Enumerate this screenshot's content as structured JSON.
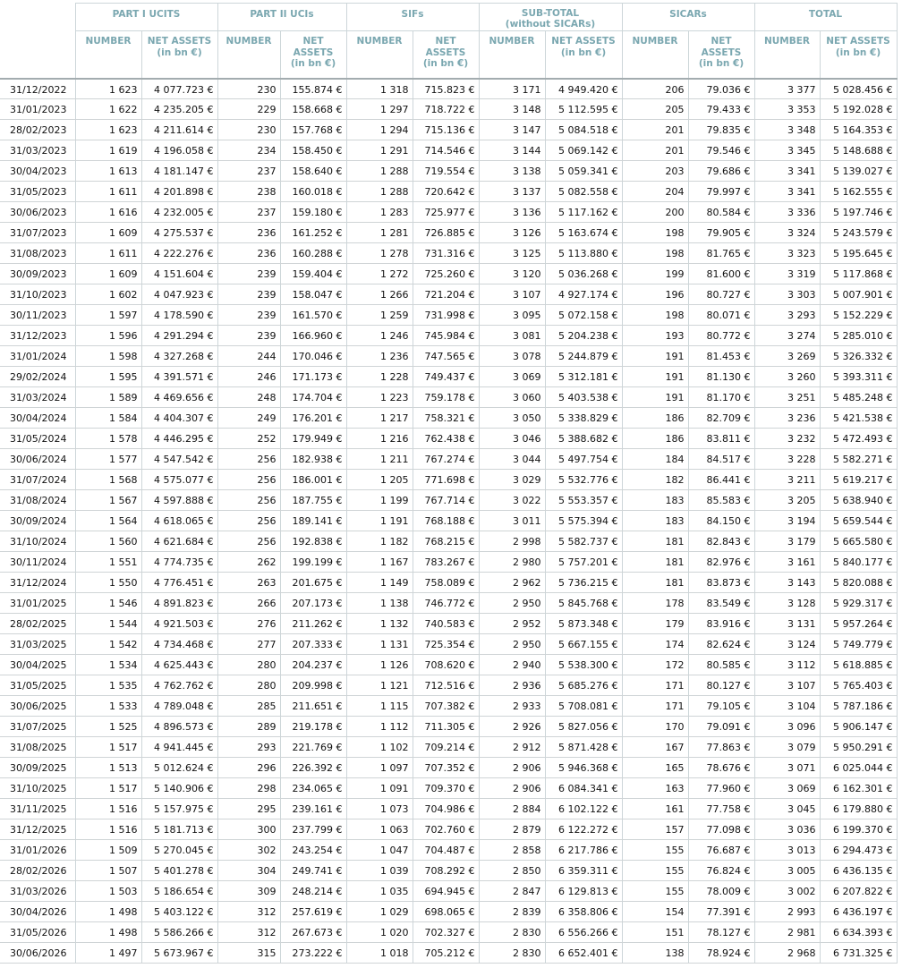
{
  "header": {
    "groups": [
      "PART I UCITS",
      "PART II UCIs",
      "SIFs",
      "SUB-TOTAL\n(without SICARs)",
      "SICARs",
      "TOTAL"
    ],
    "sub": {
      "number": "NUMBER",
      "assets_a": "NET ASSETS\n(in bn €)",
      "assets_b": "NET\nASSETS\n(in bn €)"
    }
  },
  "rows": [
    [
      "31/12/2022",
      "1 623",
      "4 077.723 €",
      "230",
      "155.874 €",
      "1 318",
      "715.823 €",
      "3 171",
      "4 949.420 €",
      "206",
      "79.036 €",
      "3 377",
      "5 028.456 €"
    ],
    [
      "31/01/2023",
      "1 622",
      "4 235.205 €",
      "229",
      "158.668 €",
      "1 297",
      "718.722 €",
      "3 148",
      "5 112.595 €",
      "205",
      "79.433 €",
      "3 353",
      "5 192.028 €"
    ],
    [
      "28/02/2023",
      "1 623",
      "4 211.614 €",
      "230",
      "157.768 €",
      "1 294",
      "715.136 €",
      "3 147",
      "5 084.518 €",
      "201",
      "79.835 €",
      "3 348",
      "5 164.353 €"
    ],
    [
      "31/03/2023",
      "1 619",
      "4 196.058 €",
      "234",
      "158.450 €",
      "1 291",
      "714.546 €",
      "3 144",
      "5 069.142 €",
      "201",
      "79.546 €",
      "3 345",
      "5 148.688 €"
    ],
    [
      "30/04/2023",
      "1 613",
      "4 181.147 €",
      "237",
      "158.640 €",
      "1 288",
      "719.554 €",
      "3 138",
      "5 059.341 €",
      "203",
      "79.686 €",
      "3 341",
      "5 139.027 €"
    ],
    [
      "31/05/2023",
      "1 611",
      "4 201.898 €",
      "238",
      "160.018 €",
      "1 288",
      "720.642 €",
      "3 137",
      "5 082.558 €",
      "204",
      "79.997 €",
      "3 341",
      "5 162.555 €"
    ],
    [
      "30/06/2023",
      "1 616",
      "4 232.005 €",
      "237",
      "159.180 €",
      "1 283",
      "725.977 €",
      "3 136",
      "5 117.162 €",
      "200",
      "80.584 €",
      "3 336",
      "5 197.746 €"
    ],
    [
      "31/07/2023",
      "1 609",
      "4 275.537 €",
      "236",
      "161.252 €",
      "1 281",
      "726.885 €",
      "3 126",
      "5 163.674 €",
      "198",
      "79.905 €",
      "3 324",
      "5 243.579 €"
    ],
    [
      "31/08/2023",
      "1 611",
      "4 222.276 €",
      "236",
      "160.288 €",
      "1 278",
      "731.316 €",
      "3 125",
      "5 113.880 €",
      "198",
      "81.765 €",
      "3 323",
      "5 195.645 €"
    ],
    [
      "30/09/2023",
      "1 609",
      "4 151.604 €",
      "239",
      "159.404 €",
      "1 272",
      "725.260 €",
      "3 120",
      "5 036.268 €",
      "199",
      "81.600 €",
      "3 319",
      "5 117.868 €"
    ],
    [
      "31/10/2023",
      "1 602",
      "4 047.923 €",
      "239",
      "158.047 €",
      "1 266",
      "721.204 €",
      "3 107",
      "4 927.174 €",
      "196",
      "80.727 €",
      "3 303",
      "5 007.901 €"
    ],
    [
      "30/11/2023",
      "1 597",
      "4 178.590 €",
      "239",
      "161.570 €",
      "1 259",
      "731.998 €",
      "3 095",
      "5 072.158 €",
      "198",
      "80.071 €",
      "3 293",
      "5 152.229 €"
    ],
    [
      "31/12/2023",
      "1 596",
      "4 291.294 €",
      "239",
      "166.960 €",
      "1 246",
      "745.984 €",
      "3 081",
      "5 204.238 €",
      "193",
      "80.772 €",
      "3 274",
      "5 285.010 €"
    ],
    [
      "31/01/2024",
      "1 598",
      "4 327.268 €",
      "244",
      "170.046 €",
      "1 236",
      "747.565 €",
      "3 078",
      "5 244.879 €",
      "191",
      "81.453 €",
      "3 269",
      "5 326.332 €"
    ],
    [
      "29/02/2024",
      "1 595",
      "4 391.571 €",
      "246",
      "171.173 €",
      "1 228",
      "749.437 €",
      "3 069",
      "5 312.181 €",
      "191",
      "81.130 €",
      "3 260",
      "5 393.311 €"
    ],
    [
      "31/03/2024",
      "1 589",
      "4 469.656 €",
      "248",
      "174.704 €",
      "1 223",
      "759.178 €",
      "3 060",
      "5 403.538 €",
      "191",
      "81.170 €",
      "3 251",
      "5 485.248 €"
    ],
    [
      "30/04/2024",
      "1 584",
      "4 404.307 €",
      "249",
      "176.201 €",
      "1 217",
      "758.321 €",
      "3 050",
      "5 338.829 €",
      "186",
      "82.709 €",
      "3 236",
      "5 421.538 €"
    ],
    [
      "31/05/2024",
      "1 578",
      "4 446.295 €",
      "252",
      "179.949 €",
      "1 216",
      "762.438 €",
      "3 046",
      "5 388.682 €",
      "186",
      "83.811 €",
      "3 232",
      "5 472.493 €"
    ],
    [
      "30/06/2024",
      "1 577",
      "4 547.542 €",
      "256",
      "182.938 €",
      "1 211",
      "767.274 €",
      "3 044",
      "5 497.754 €",
      "184",
      "84.517 €",
      "3 228",
      "5 582.271 €"
    ],
    [
      "31/07/2024",
      "1 568",
      "4 575.077 €",
      "256",
      "186.001 €",
      "1 205",
      "771.698 €",
      "3 029",
      "5 532.776 €",
      "182",
      "86.441 €",
      "3 211",
      "5 619.217 €"
    ],
    [
      "31/08/2024",
      "1 567",
      "4 597.888 €",
      "256",
      "187.755 €",
      "1 199",
      "767.714 €",
      "3 022",
      "5 553.357 €",
      "183",
      "85.583 €",
      "3 205",
      "5 638.940 €"
    ],
    [
      "30/09/2024",
      "1 564",
      "4 618.065 €",
      "256",
      "189.141 €",
      "1 191",
      "768.188 €",
      "3 011",
      "5 575.394 €",
      "183",
      "84.150 €",
      "3 194",
      "5 659.544 €"
    ],
    [
      "31/10/2024",
      "1 560",
      "4 621.684 €",
      "256",
      "192.838 €",
      "1 182",
      "768.215 €",
      "2 998",
      "5 582.737 €",
      "181",
      "82.843 €",
      "3 179",
      "5 665.580 €"
    ],
    [
      "30/11/2024",
      "1 551",
      "4 774.735 €",
      "262",
      "199.199 €",
      "1 167",
      "783.267 €",
      "2 980",
      "5 757.201 €",
      "181",
      "82.976 €",
      "3 161",
      "5 840.177 €"
    ],
    [
      "31/12/2024",
      "1 550",
      "4 776.451 €",
      "263",
      "201.675 €",
      "1 149",
      "758.089 €",
      "2 962",
      "5 736.215 €",
      "181",
      "83.873 €",
      "3 143",
      "5 820.088 €"
    ],
    [
      "31/01/2025",
      "1 546",
      "4 891.823 €",
      "266",
      "207.173 €",
      "1 138",
      "746.772 €",
      "2 950",
      "5 845.768 €",
      "178",
      "83.549 €",
      "3 128",
      "5 929.317 €"
    ],
    [
      "28/02/2025",
      "1 544",
      "4 921.503 €",
      "276",
      "211.262 €",
      "1 132",
      "740.583 €",
      "2 952",
      "5 873.348 €",
      "179",
      "83.916 €",
      "3 131",
      "5 957.264 €"
    ],
    [
      "31/03/2025",
      "1 542",
      "4 734.468 €",
      "277",
      "207.333 €",
      "1 131",
      "725.354 €",
      "2 950",
      "5 667.155 €",
      "174",
      "82.624 €",
      "3 124",
      "5 749.779 €"
    ],
    [
      "30/04/2025",
      "1 534",
      "4 625.443 €",
      "280",
      "204.237 €",
      "1 126",
      "708.620 €",
      "2 940",
      "5 538.300 €",
      "172",
      "80.585 €",
      "3 112",
      "5 618.885 €"
    ],
    [
      "31/05/2025",
      "1 535",
      "4 762.762 €",
      "280",
      "209.998 €",
      "1 121",
      "712.516 €",
      "2 936",
      "5 685.276 €",
      "171",
      "80.127 €",
      "3 107",
      "5 765.403 €"
    ],
    [
      "30/06/2025",
      "1 533",
      "4 789.048 €",
      "285",
      "211.651 €",
      "1 115",
      "707.382 €",
      "2 933",
      "5 708.081 €",
      "171",
      "79.105 €",
      "3 104",
      "5 787.186 €"
    ],
    [
      "31/07/2025",
      "1 525",
      "4 896.573 €",
      "289",
      "219.178 €",
      "1 112",
      "711.305 €",
      "2 926",
      "5 827.056 €",
      "170",
      "79.091 €",
      "3 096",
      "5 906.147 €"
    ],
    [
      "31/08/2025",
      "1 517",
      "4 941.445 €",
      "293",
      "221.769 €",
      "1 102",
      "709.214 €",
      "2 912",
      "5 871.428 €",
      "167",
      "77.863 €",
      "3 079",
      "5 950.291 €"
    ],
    [
      "30/09/2025",
      "1 513",
      "5 012.624 €",
      "296",
      "226.392 €",
      "1 097",
      "707.352 €",
      "2 906",
      "5 946.368 €",
      "165",
      "78.676 €",
      "3 071",
      "6 025.044 €"
    ],
    [
      "31/10/2025",
      "1 517",
      "5 140.906 €",
      "298",
      "234.065 €",
      "1 091",
      "709.370 €",
      "2 906",
      "6 084.341 €",
      "163",
      "77.960 €",
      "3 069",
      "6 162.301 €"
    ],
    [
      "31/11/2025",
      "1 516",
      "5 157.975 €",
      "295",
      "239.161 €",
      "1 073",
      "704.986 €",
      "2 884",
      "6 102.122 €",
      "161",
      "77.758 €",
      "3 045",
      "6 179.880 €"
    ],
    [
      "31/12/2025",
      "1 516",
      "5 181.713 €",
      "300",
      "237.799 €",
      "1 063",
      "702.760 €",
      "2 879",
      "6 122.272 €",
      "157",
      "77.098 €",
      "3 036",
      "6 199.370 €"
    ],
    [
      "31/01/2026",
      "1 509",
      "5 270.045 €",
      "302",
      "243.254 €",
      "1 047",
      "704.487 €",
      "2 858",
      "6 217.786 €",
      "155",
      "76.687 €",
      "3 013",
      "6 294.473 €"
    ],
    [
      "28/02/2026",
      "1 507",
      "5 401.278 €",
      "304",
      "249.741 €",
      "1 039",
      "708.292 €",
      "2 850",
      "6 359.311 €",
      "155",
      "76.824 €",
      "3 005",
      "6 436.135 €"
    ],
    [
      "31/03/2026",
      "1 503",
      "5 186.654 €",
      "309",
      "248.214 €",
      "1 035",
      "694.945 €",
      "2 847",
      "6 129.813 €",
      "155",
      "78.009 €",
      "3 002",
      "6 207.822 €"
    ],
    [
      "30/04/2026",
      "1 498",
      "5 403.122 €",
      "312",
      "257.619 €",
      "1 029",
      "698.065 €",
      "2 839",
      "6 358.806 €",
      "154",
      "77.391 €",
      "2 993",
      "6 436.197 €"
    ],
    [
      "31/05/2026",
      "1 498",
      "5 586.266 €",
      "312",
      "267.673 €",
      "1 020",
      "702.327 €",
      "2 830",
      "6 556.266 €",
      "151",
      "78.127 €",
      "2 981",
      "6 634.393 €"
    ],
    [
      "30/06/2026",
      "1 497",
      "5 673.967 €",
      "315",
      "273.222 €",
      "1 018",
      "705.212 €",
      "2 830",
      "6 652.401 €",
      "138",
      "78.924 €",
      "2 968",
      "6 731.325 €"
    ]
  ]
}
